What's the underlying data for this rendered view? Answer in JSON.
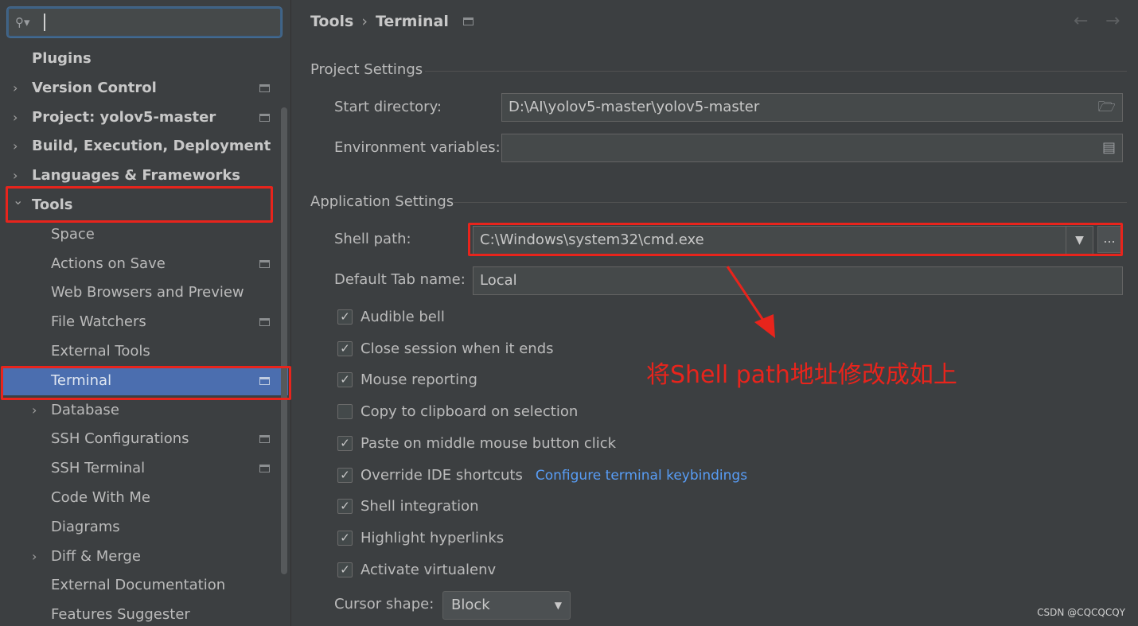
{
  "search": {
    "placeholder": ""
  },
  "sidebar": {
    "items": [
      {
        "label": "Plugins",
        "level": 0,
        "expandable": false,
        "bold": true
      },
      {
        "label": "Version Control",
        "level": 0,
        "expandable": true,
        "bold": true,
        "project": true
      },
      {
        "label": "Project: yolov5-master",
        "level": 0,
        "expandable": true,
        "bold": true,
        "project": true
      },
      {
        "label": "Build, Execution, Deployment",
        "level": 0,
        "expandable": true,
        "bold": true
      },
      {
        "label": "Languages & Frameworks",
        "level": 0,
        "expandable": true,
        "bold": true
      },
      {
        "label": "Tools",
        "level": 0,
        "expanded": true,
        "bold": true
      },
      {
        "label": "Space",
        "level": 1
      },
      {
        "label": "Actions on Save",
        "level": 1,
        "project": true
      },
      {
        "label": "Web Browsers and Preview",
        "level": 1
      },
      {
        "label": "File Watchers",
        "level": 1,
        "project": true
      },
      {
        "label": "External Tools",
        "level": 1
      },
      {
        "label": "Terminal",
        "level": 1,
        "project": true,
        "selected": true
      },
      {
        "label": "Database",
        "level": 1,
        "expandable": true
      },
      {
        "label": "SSH Configurations",
        "level": 1,
        "project": true
      },
      {
        "label": "SSH Terminal",
        "level": 1,
        "project": true
      },
      {
        "label": "Code With Me",
        "level": 1
      },
      {
        "label": "Diagrams",
        "level": 1
      },
      {
        "label": "Diff & Merge",
        "level": 1,
        "expandable": true
      },
      {
        "label": "External Documentation",
        "level": 1
      },
      {
        "label": "Features Suggester",
        "level": 1
      }
    ]
  },
  "breadcrumb": {
    "parent": "Tools",
    "separator": "›",
    "current": "Terminal"
  },
  "nav": {
    "back": "←",
    "forward": "→"
  },
  "project_settings": {
    "title": "Project Settings",
    "start_directory_label": "Start directory:",
    "start_directory_value": "D:\\AI\\yolov5-master\\yolov5-master",
    "env_vars_label": "Environment variables:",
    "env_vars_value": ""
  },
  "app_settings": {
    "title": "Application Settings",
    "shell_path_label": "Shell path:",
    "shell_path_value": "C:\\Windows\\system32\\cmd.exe",
    "browse_label": "...",
    "default_tab_label": "Default Tab name:",
    "default_tab_value": "Local",
    "checkboxes": [
      {
        "label": "Audible bell",
        "checked": true
      },
      {
        "label": "Close session when it ends",
        "checked": true
      },
      {
        "label": "Mouse reporting",
        "checked": true
      },
      {
        "label": "Copy to clipboard on selection",
        "checked": false
      },
      {
        "label": "Paste on middle mouse button click",
        "checked": true
      },
      {
        "label": "Override IDE shortcuts",
        "checked": true,
        "link": "Configure terminal keybindings"
      },
      {
        "label": "Shell integration",
        "checked": true
      },
      {
        "label": "Highlight hyperlinks",
        "checked": true
      },
      {
        "label": "Activate virtualenv",
        "checked": true
      }
    ],
    "cursor_shape_label": "Cursor shape:",
    "cursor_shape_value": "Block"
  },
  "annotation": "将Shell path地址修改成如上",
  "watermark": "CSDN @CQCQCQY",
  "colors": {
    "selection": "#4b6eaf",
    "highlight_red": "#e8241c",
    "link": "#589df6",
    "background": "#3c3f41"
  },
  "icons": {
    "search": "search-icon",
    "folder": "folder-icon",
    "env": "document-icon",
    "project_scope": "project-scope-icon"
  }
}
